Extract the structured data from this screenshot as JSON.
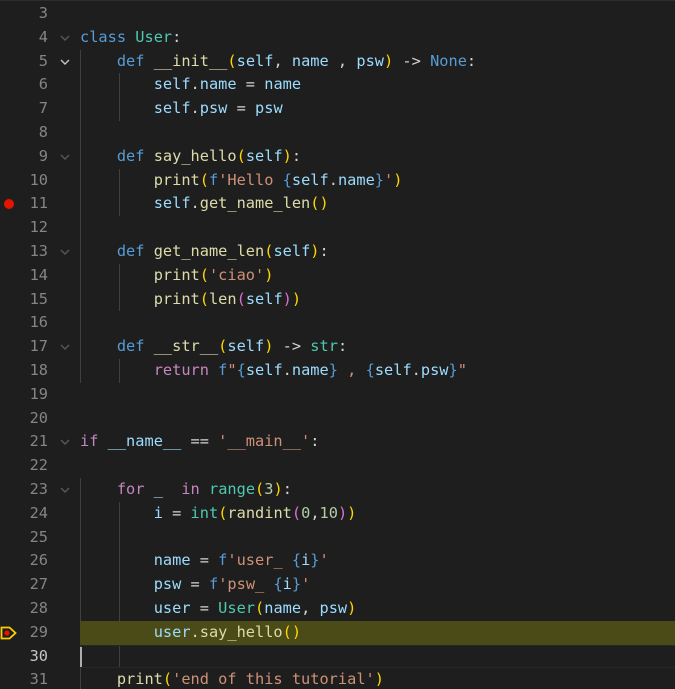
{
  "editor": {
    "language": "python",
    "breakpoint_line": 11,
    "debug_current_line": 29,
    "cursor_line": 30,
    "lines": [
      {
        "n": 3,
        "tokens": [],
        "fold": ""
      },
      {
        "n": 4,
        "fold": "collapsed-hint",
        "tokens": [
          [
            "kw",
            "class"
          ],
          [
            "op",
            " "
          ],
          [
            "cls",
            "User"
          ],
          [
            "op",
            ":"
          ]
        ]
      },
      {
        "n": 5,
        "fold": "open",
        "tokens": [
          [
            "op",
            "    "
          ],
          [
            "kw",
            "def"
          ],
          [
            "op",
            " "
          ],
          [
            "fn",
            "__init__"
          ],
          [
            "b1",
            "("
          ],
          [
            "var",
            "self"
          ],
          [
            "op",
            ", "
          ],
          [
            "var",
            "name"
          ],
          [
            "op",
            " , "
          ],
          [
            "var",
            "psw"
          ],
          [
            "b1",
            ")"
          ],
          [
            "op",
            " -> "
          ],
          [
            "kw",
            "None"
          ],
          [
            "op",
            ":"
          ]
        ]
      },
      {
        "n": 6,
        "fold": "",
        "tokens": [
          [
            "op",
            "        "
          ],
          [
            "var",
            "self"
          ],
          [
            "op",
            "."
          ],
          [
            "var",
            "name"
          ],
          [
            "op",
            " = "
          ],
          [
            "var",
            "name"
          ]
        ]
      },
      {
        "n": 7,
        "fold": "",
        "tokens": [
          [
            "op",
            "        "
          ],
          [
            "var",
            "self"
          ],
          [
            "op",
            "."
          ],
          [
            "var",
            "psw"
          ],
          [
            "op",
            " = "
          ],
          [
            "var",
            "psw"
          ]
        ]
      },
      {
        "n": 8,
        "fold": "",
        "tokens": []
      },
      {
        "n": 9,
        "fold": "collapsed-hint",
        "tokens": [
          [
            "op",
            "    "
          ],
          [
            "kw",
            "def"
          ],
          [
            "op",
            " "
          ],
          [
            "fn",
            "say_hello"
          ],
          [
            "b1",
            "("
          ],
          [
            "var",
            "self"
          ],
          [
            "b1",
            ")"
          ],
          [
            "op",
            ":"
          ]
        ]
      },
      {
        "n": 10,
        "fold": "",
        "tokens": [
          [
            "op",
            "        "
          ],
          [
            "fn",
            "print"
          ],
          [
            "b1",
            "("
          ],
          [
            "kw",
            "f"
          ],
          [
            "str",
            "'Hello "
          ],
          [
            "kw",
            "{"
          ],
          [
            "var",
            "self"
          ],
          [
            "op",
            "."
          ],
          [
            "var",
            "name"
          ],
          [
            "kw",
            "}"
          ],
          [
            "str",
            "'"
          ],
          [
            "b1",
            ")"
          ]
        ]
      },
      {
        "n": 11,
        "fold": "",
        "tokens": [
          [
            "op",
            "        "
          ],
          [
            "var",
            "self"
          ],
          [
            "op",
            "."
          ],
          [
            "fn",
            "get_name_len"
          ],
          [
            "b1",
            "()"
          ]
        ]
      },
      {
        "n": 12,
        "fold": "",
        "tokens": []
      },
      {
        "n": 13,
        "fold": "collapsed-hint",
        "tokens": [
          [
            "op",
            "    "
          ],
          [
            "kw",
            "def"
          ],
          [
            "op",
            " "
          ],
          [
            "fn",
            "get_name_len"
          ],
          [
            "b1",
            "("
          ],
          [
            "var",
            "self"
          ],
          [
            "b1",
            ")"
          ],
          [
            "op",
            ":"
          ]
        ]
      },
      {
        "n": 14,
        "fold": "",
        "tokens": [
          [
            "op",
            "        "
          ],
          [
            "fn",
            "print"
          ],
          [
            "b1",
            "("
          ],
          [
            "str",
            "'ciao'"
          ],
          [
            "b1",
            ")"
          ]
        ]
      },
      {
        "n": 15,
        "fold": "",
        "tokens": [
          [
            "op",
            "        "
          ],
          [
            "fn",
            "print"
          ],
          [
            "b1",
            "("
          ],
          [
            "fn",
            "len"
          ],
          [
            "b2",
            "("
          ],
          [
            "var",
            "self"
          ],
          [
            "b2",
            ")"
          ],
          [
            "b1",
            ")"
          ]
        ]
      },
      {
        "n": 16,
        "fold": "",
        "tokens": []
      },
      {
        "n": 17,
        "fold": "collapsed-hint",
        "tokens": [
          [
            "op",
            "    "
          ],
          [
            "kw",
            "def"
          ],
          [
            "op",
            " "
          ],
          [
            "fn",
            "__str__"
          ],
          [
            "b1",
            "("
          ],
          [
            "var",
            "self"
          ],
          [
            "b1",
            ")"
          ],
          [
            "op",
            " -> "
          ],
          [
            "cls",
            "str"
          ],
          [
            "op",
            ":"
          ]
        ]
      },
      {
        "n": 18,
        "fold": "",
        "tokens": [
          [
            "op",
            "        "
          ],
          [
            "kw2",
            "return"
          ],
          [
            "op",
            " "
          ],
          [
            "kw",
            "f"
          ],
          [
            "str",
            "\""
          ],
          [
            "kw",
            "{"
          ],
          [
            "var",
            "self"
          ],
          [
            "op",
            "."
          ],
          [
            "var",
            "name"
          ],
          [
            "kw",
            "}"
          ],
          [
            "str",
            " , "
          ],
          [
            "kw",
            "{"
          ],
          [
            "var",
            "self"
          ],
          [
            "op",
            "."
          ],
          [
            "var",
            "psw"
          ],
          [
            "kw",
            "}"
          ],
          [
            "str",
            "\""
          ]
        ]
      },
      {
        "n": 19,
        "fold": "",
        "tokens": []
      },
      {
        "n": 20,
        "fold": "",
        "tokens": []
      },
      {
        "n": 21,
        "fold": "collapsed-hint",
        "tokens": [
          [
            "kw2",
            "if"
          ],
          [
            "op",
            " "
          ],
          [
            "var",
            "__name__"
          ],
          [
            "op",
            " == "
          ],
          [
            "str",
            "'__main__'"
          ],
          [
            "op",
            ":"
          ]
        ]
      },
      {
        "n": 22,
        "fold": "",
        "tokens": []
      },
      {
        "n": 23,
        "fold": "collapsed-hint",
        "tokens": [
          [
            "op",
            "    "
          ],
          [
            "kw2",
            "for"
          ],
          [
            "op",
            " "
          ],
          [
            "var",
            "_"
          ],
          [
            "op",
            "  "
          ],
          [
            "kw2",
            "in"
          ],
          [
            "op",
            " "
          ],
          [
            "cls",
            "range"
          ],
          [
            "b1",
            "("
          ],
          [
            "num",
            "3"
          ],
          [
            "b1",
            ")"
          ],
          [
            "op",
            ":"
          ]
        ]
      },
      {
        "n": 24,
        "fold": "",
        "tokens": [
          [
            "op",
            "        "
          ],
          [
            "var",
            "i"
          ],
          [
            "op",
            " = "
          ],
          [
            "cls",
            "int"
          ],
          [
            "b1",
            "("
          ],
          [
            "fn",
            "randint"
          ],
          [
            "b2",
            "("
          ],
          [
            "num",
            "0"
          ],
          [
            "op",
            ","
          ],
          [
            "num",
            "10"
          ],
          [
            "b2",
            ")"
          ],
          [
            "b1",
            ")"
          ]
        ]
      },
      {
        "n": 25,
        "fold": "",
        "tokens": []
      },
      {
        "n": 26,
        "fold": "",
        "tokens": [
          [
            "op",
            "        "
          ],
          [
            "var",
            "name"
          ],
          [
            "op",
            " = "
          ],
          [
            "kw",
            "f"
          ],
          [
            "str",
            "'user_ "
          ],
          [
            "kw",
            "{"
          ],
          [
            "var",
            "i"
          ],
          [
            "kw",
            "}"
          ],
          [
            "str",
            "'"
          ]
        ]
      },
      {
        "n": 27,
        "fold": "",
        "tokens": [
          [
            "op",
            "        "
          ],
          [
            "var",
            "psw"
          ],
          [
            "op",
            " = "
          ],
          [
            "kw",
            "f"
          ],
          [
            "str",
            "'psw_ "
          ],
          [
            "kw",
            "{"
          ],
          [
            "var",
            "i"
          ],
          [
            "kw",
            "}"
          ],
          [
            "str",
            "'"
          ]
        ]
      },
      {
        "n": 28,
        "fold": "",
        "tokens": [
          [
            "op",
            "        "
          ],
          [
            "var",
            "user"
          ],
          [
            "op",
            " = "
          ],
          [
            "cls",
            "User"
          ],
          [
            "b1",
            "("
          ],
          [
            "var",
            "name"
          ],
          [
            "op",
            ", "
          ],
          [
            "var",
            "psw"
          ],
          [
            "b1",
            ")"
          ]
        ]
      },
      {
        "n": 29,
        "fold": "",
        "tokens": [
          [
            "op",
            "        "
          ],
          [
            "var",
            "user"
          ],
          [
            "op",
            "."
          ],
          [
            "fn",
            "say_hello"
          ],
          [
            "b1",
            "()"
          ]
        ]
      },
      {
        "n": 30,
        "fold": "",
        "tokens": []
      },
      {
        "n": 31,
        "fold": "",
        "tokens": [
          [
            "op",
            "    "
          ],
          [
            "fn",
            "print"
          ],
          [
            "b1",
            "("
          ],
          [
            "str",
            "'end of this tutorial'"
          ],
          [
            "b1",
            ")"
          ]
        ]
      }
    ]
  },
  "colors": {
    "background": "#1e1e1e",
    "breakpoint": "#e51400",
    "debug_line_bg": "#4b4b18",
    "debug_arrow": "#ffcc00"
  },
  "icons": {
    "breakpoint": "breakpoint-dot-icon",
    "debug_pointer": "debug-stackframe-icon",
    "fold": "chevron-down-icon"
  }
}
